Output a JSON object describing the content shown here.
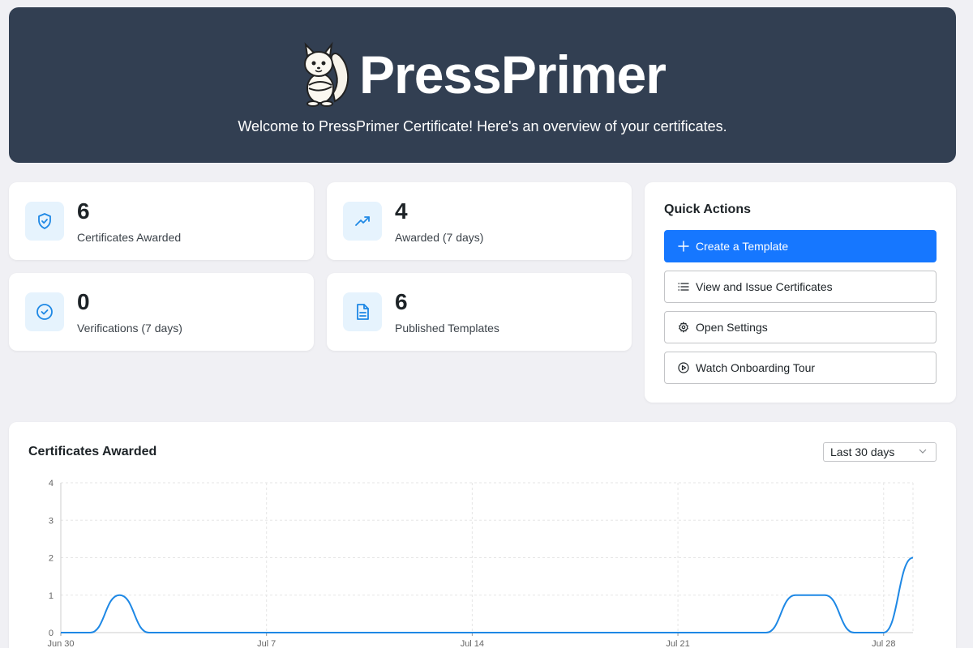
{
  "header": {
    "brand_name": "PressPrimer",
    "tagline": "Welcome to PressPrimer Certificate! Here's an overview of your certificates."
  },
  "stats": [
    {
      "icon": "shield-check-icon",
      "value": "6",
      "label": "Certificates Awarded"
    },
    {
      "icon": "trending-up-icon",
      "value": "4",
      "label": "Awarded (7 days)"
    },
    {
      "icon": "check-circle-icon",
      "value": "0",
      "label": "Verifications (7 days)"
    },
    {
      "icon": "document-icon",
      "value": "6",
      "label": "Published Templates"
    }
  ],
  "quick_actions": {
    "title": "Quick Actions",
    "buttons": [
      {
        "icon": "plus-icon",
        "label": "Create a Template"
      },
      {
        "icon": "list-icon",
        "label": "View and Issue Certificates"
      },
      {
        "icon": "gear-icon",
        "label": "Open Settings"
      },
      {
        "icon": "play-circle-icon",
        "label": "Watch Onboarding Tour"
      }
    ]
  },
  "colors": {
    "header_bg": "#323f52",
    "primary": "#1677ff",
    "icon_accent": "#1e88e5",
    "icon_bg": "#e6f3fd",
    "line": "#1e88e5"
  },
  "chart": {
    "title": "Certificates Awarded",
    "range_selected": "Last 30 days"
  },
  "chart_data": {
    "type": "line",
    "title": "Certificates Awarded",
    "x_tick_labels": [
      "Jun 30",
      "Jul 7",
      "Jul 14",
      "Jul 21",
      "Jul 28"
    ],
    "x": [
      "Jun 30",
      "Jul 1",
      "Jul 2",
      "Jul 3",
      "Jul 4",
      "Jul 5",
      "Jul 6",
      "Jul 7",
      "Jul 8",
      "Jul 9",
      "Jul 10",
      "Jul 11",
      "Jul 12",
      "Jul 13",
      "Jul 14",
      "Jul 15",
      "Jul 16",
      "Jul 17",
      "Jul 18",
      "Jul 19",
      "Jul 20",
      "Jul 21",
      "Jul 22",
      "Jul 23",
      "Jul 24",
      "Jul 25",
      "Jul 26",
      "Jul 27",
      "Jul 28",
      "Jul 29"
    ],
    "series": [
      {
        "values": [
          0,
          0,
          1,
          0,
          0,
          0,
          0,
          0,
          0,
          0,
          0,
          0,
          0,
          0,
          0,
          0,
          0,
          0,
          0,
          0,
          0,
          0,
          0,
          0,
          0,
          1,
          1,
          0,
          0,
          2
        ]
      }
    ],
    "yticks": [
      0,
      1,
      2,
      3,
      4
    ],
    "ylim": [
      0,
      4
    ],
    "grid": true,
    "legend": "none"
  }
}
